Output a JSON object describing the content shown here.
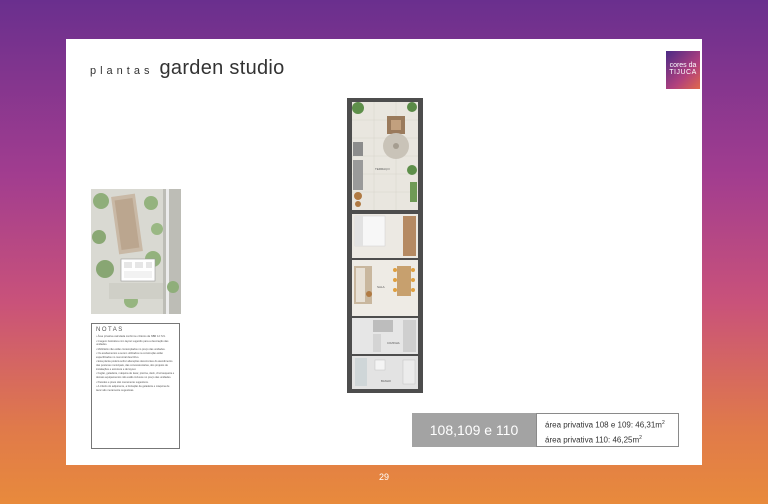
{
  "header": {
    "subtitle": "plantas",
    "title": "garden studio"
  },
  "logo": {
    "line1": "cores da",
    "line2": "TIJUCA"
  },
  "notes": {
    "title": "NOTAS",
    "items": [
      "• Área privativa calculada conforme critérios da NBR 12.721.",
      "• Imagem ilustrativa com layout sugerido para a decoração das unidades.",
      "• Mobiliário não estão contemplados no preço das unidades.",
      "• Os acabamentos a serem utilizados na construção estão especificados no memorial descritivo.",
      "• Esta planta poderá sofrer alterações decorrentes do atendimento das posturas municipais, das concessionárias, dos projetos de instalações e estrutura e de layout.",
      "• Fogão, geladeira, máquina de lavar, piscina, deck, churrasqueira e demais equipamentos não estão inclusos no preço das unidades.",
      "• Paredes e pisos são meramente sugestivos.",
      "• A critério do adquirente, a limitação da geladeira e máquina de lavar são meramente sugestivas."
    ]
  },
  "plan": {
    "rooms": [
      "TERRAÇO",
      "SALA",
      "COZINHA",
      "BANHO"
    ]
  },
  "units": "108,109 e 110",
  "areas": {
    "line1": "área privativa  108 e 109: 46,31m",
    "line2": "área privativa 110: 46,25m",
    "unit_sup": "2"
  },
  "page_number": "29"
}
